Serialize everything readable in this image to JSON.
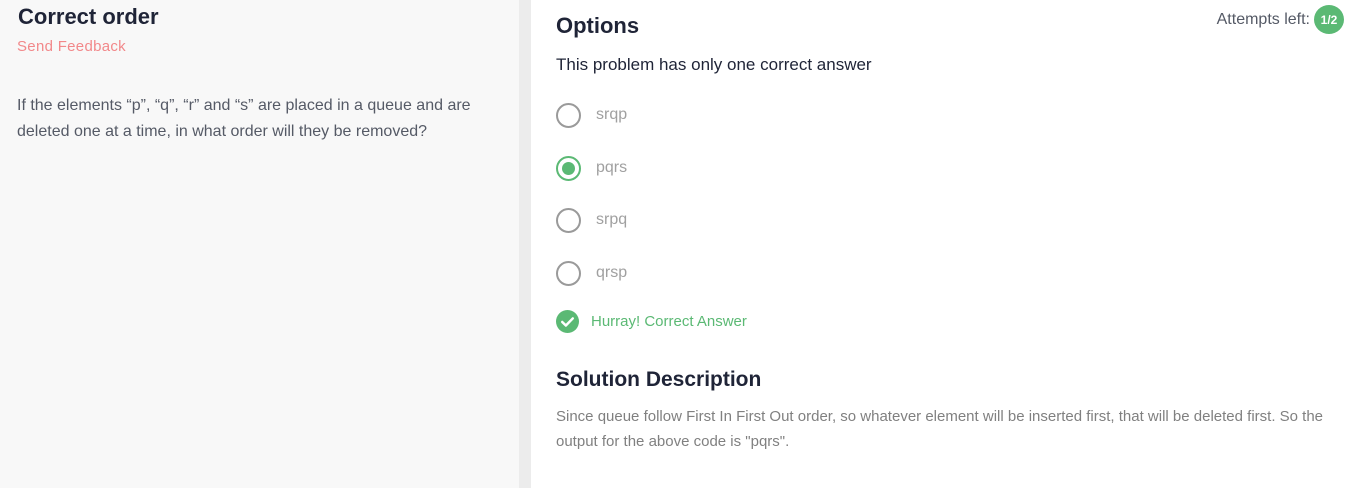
{
  "problem": {
    "title": "Correct order",
    "feedback_link": "Send Feedback",
    "question": "If the elements “p”, “q”, “r” and “s” are placed in a queue and are deleted one at a time, in what order will they be removed?"
  },
  "options_panel": {
    "title": "Options",
    "attempts_label": "Attempts left:",
    "attempts_value": "1/2",
    "subtitle": "This problem has only one correct answer",
    "options": [
      {
        "label": "srqp",
        "selected": false
      },
      {
        "label": "pqrs",
        "selected": true
      },
      {
        "label": "srpq",
        "selected": false
      },
      {
        "label": "qrsp",
        "selected": false
      }
    ],
    "result_text": "Hurray! Correct Answer"
  },
  "solution": {
    "title": "Solution Description",
    "text": "Since queue follow First In First Out order, so whatever element will be inserted first, that will be deleted first. So the output for the above code is \"pqrs\"."
  },
  "colors": {
    "accent_green": "#5bb974",
    "feedback_pink": "#f2888a",
    "heading_dark": "#1f2437"
  }
}
